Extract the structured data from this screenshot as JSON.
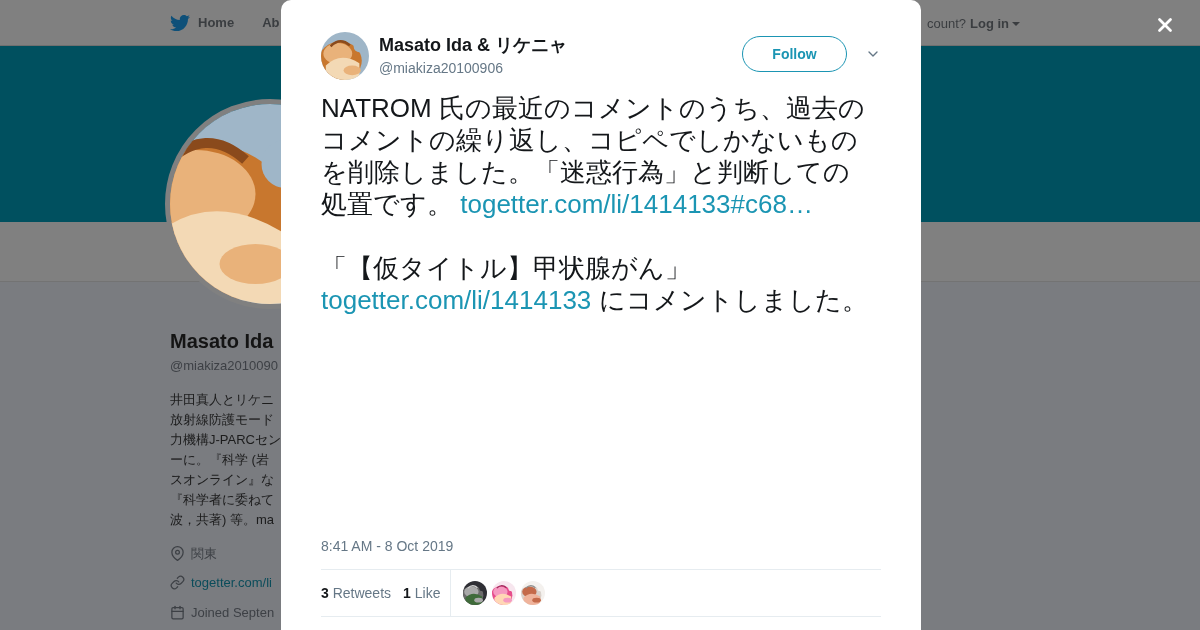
{
  "background_page": {
    "nav": [
      {
        "label": "Home",
        "kind": "home"
      },
      {
        "label": "Ab",
        "kind": "plain"
      }
    ],
    "account_prompt": "count?",
    "login": "Log in",
    "profile": {
      "name": "Masato Ida",
      "handle": "@miakiza2010090",
      "bio_lines": [
        "井田真人とリケニ",
        "放射線防護モード",
        "力機構J-PARCセン",
        "ーに。『科学 (岩",
        "スオンライン』な",
        "『科学者に委ねて",
        "波，共著) 等。ma"
      ],
      "location": "関東",
      "url": "togetter.com/li",
      "joined": "Joined Septen"
    }
  },
  "tweet": {
    "author": {
      "name": "Masato Ida & リケニャ",
      "handle": "@miakiza20100906"
    },
    "follow": "Follow",
    "paragraphs": [
      [
        {
          "kind": "text",
          "text": "NATROM 氏の最近のコメントのうち、過去のコメントの繰り返し、コピペでしかないものを削除しました。「迷惑行為」と判断しての処置です。 "
        },
        {
          "kind": "link",
          "text": "togetter.com/li/1414133#c68…"
        }
      ],
      [
        {
          "kind": "text",
          "text": "「【仮タイトル】甲状腺がん」"
        },
        {
          "kind": "link",
          "text": "togetter.com/li/1414133"
        },
        {
          "kind": "text",
          "text": " にコメントしました。"
        }
      ]
    ],
    "time": "8:41 AM - 8 Oct 2019",
    "stats": [
      {
        "count": "3",
        "label": "Retweets"
      },
      {
        "count": "1",
        "label": "Like"
      }
    ],
    "likers": [
      {
        "kind": "picture"
      },
      {
        "kind": "picture"
      },
      {
        "kind": "picture"
      }
    ]
  }
}
